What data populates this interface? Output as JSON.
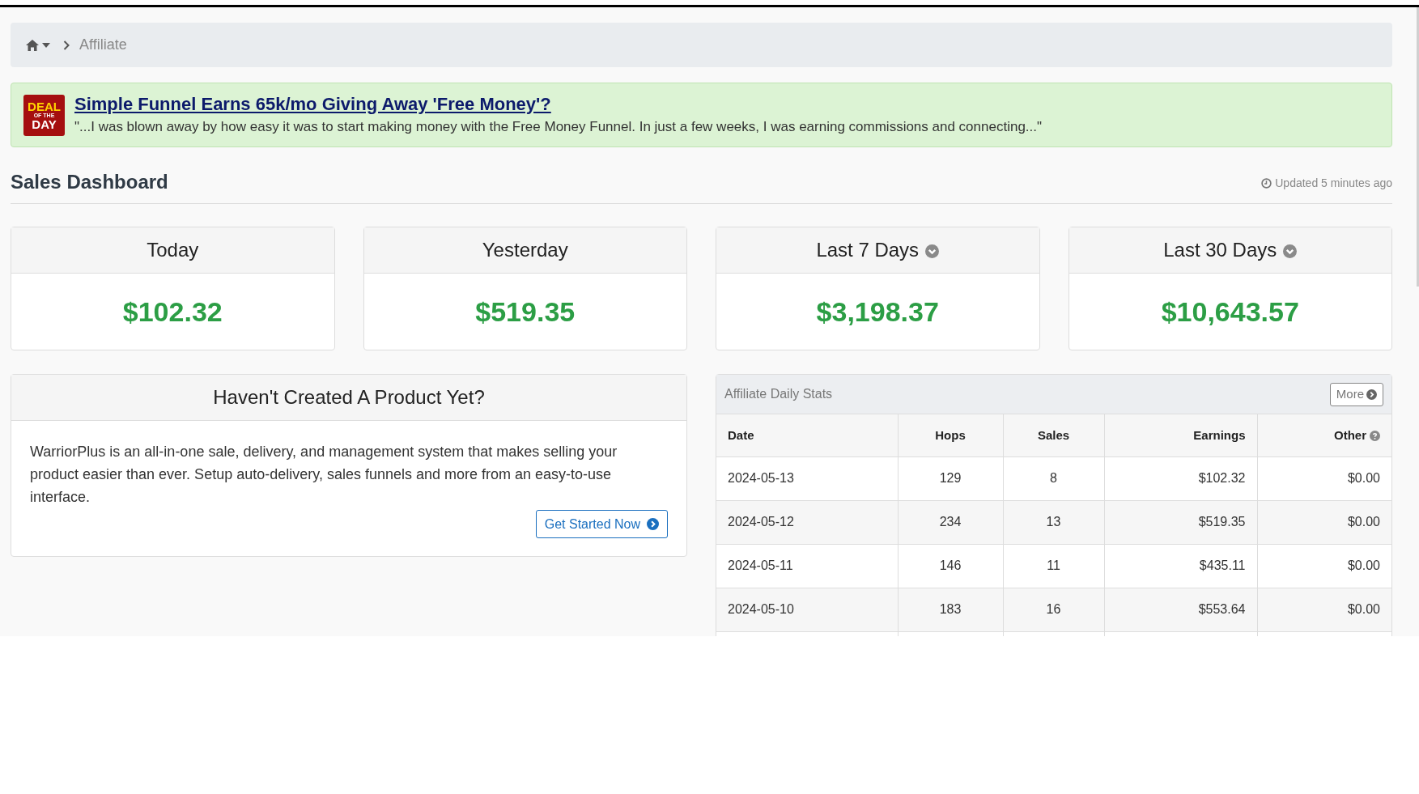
{
  "breadcrumb": {
    "current": "Affiliate"
  },
  "deal": {
    "logo_lines": [
      "DEAL",
      "OF THE",
      "DAY"
    ],
    "title": "Simple Funnel Earns 65k/mo Giving Away 'Free Money'?",
    "quote": "\"...I was blown away by how easy it was to start making money with the Free Money Funnel. In just a few weeks, I was earning commissions and connecting...\""
  },
  "dashboard": {
    "title": "Sales Dashboard",
    "updated": "Updated 5 minutes ago"
  },
  "stat_cards": [
    {
      "label": "Today",
      "value": "$102.32",
      "dropdown": false
    },
    {
      "label": "Yesterday",
      "value": "$519.35",
      "dropdown": false
    },
    {
      "label": "Last 7 Days",
      "value": "$3,198.37",
      "dropdown": true
    },
    {
      "label": "Last 30 Days",
      "value": "$10,643.57",
      "dropdown": true
    }
  ],
  "promo": {
    "title": "Haven't Created A Product Yet?",
    "body": "WarriorPlus is an all-in-one sale, delivery, and management system that makes selling your product easier than ever. Setup auto-delivery, sales funnels and more from an easy-to-use interface.",
    "button": "Get Started Now"
  },
  "daily_stats": {
    "title": "Affiliate Daily Stats",
    "more_button": "More",
    "columns": [
      "Date",
      "Hops",
      "Sales",
      "Earnings",
      "Other"
    ],
    "rows": [
      [
        "2024-05-13",
        "129",
        "8",
        "$102.32",
        "$0.00"
      ],
      [
        "2024-05-12",
        "234",
        "13",
        "$519.35",
        "$0.00"
      ],
      [
        "2024-05-11",
        "146",
        "11",
        "$435.11",
        "$0.00"
      ],
      [
        "2024-05-10",
        "183",
        "16",
        "$553.64",
        "$0.00"
      ]
    ]
  }
}
